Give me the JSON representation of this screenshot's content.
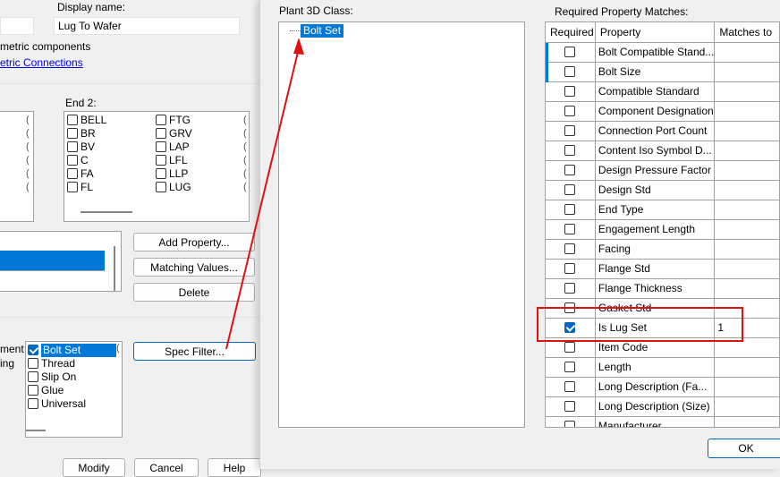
{
  "left_dialog": {
    "display_name_label": "Display name:",
    "display_name_value": "Lug To Wafer",
    "metric_components": "metric components",
    "metric_connections": "etric Connections",
    "end2_label": "End 2:",
    "end2_col1": [
      "BELL",
      "BR",
      "BV",
      "C",
      "FA",
      "FL"
    ],
    "end2_col2": [
      "FTG",
      "GRV",
      "LAP",
      "LFL",
      "LLP",
      "LUG"
    ],
    "add_property": "Add Property...",
    "matching_values": "Matching Values...",
    "delete": "Delete",
    "spec_filter": "Spec Filter...",
    "cut_label_1": "ment R",
    "cut_label_2": "ing",
    "spec_items": [
      {
        "label": "Bolt Set",
        "checked": true,
        "selected": true
      },
      {
        "label": "Thread",
        "checked": false
      },
      {
        "label": "Slip On",
        "checked": false
      },
      {
        "label": "Glue",
        "checked": false
      },
      {
        "label": "Universal",
        "checked": false
      }
    ],
    "modify": "Modify",
    "cancel": "Cancel",
    "help": "Help"
  },
  "right_dialog": {
    "plant_class_label": "Plant 3D Class:",
    "tree_selected": "Bolt Set",
    "required_label": "Required Property Matches:",
    "columns": [
      "Required",
      "Property",
      "Matches to"
    ],
    "rows": [
      {
        "property": "Bolt Compatible Stand...",
        "checked": false,
        "matches": ""
      },
      {
        "property": "Bolt Size",
        "checked": false,
        "matches": ""
      },
      {
        "property": "Compatible Standard",
        "checked": false,
        "matches": ""
      },
      {
        "property": "Component Designation",
        "checked": false,
        "matches": ""
      },
      {
        "property": "Connection Port Count",
        "checked": false,
        "matches": ""
      },
      {
        "property": "Content Iso Symbol D...",
        "checked": false,
        "matches": ""
      },
      {
        "property": "Design Pressure Factor",
        "checked": false,
        "matches": ""
      },
      {
        "property": "Design Std",
        "checked": false,
        "matches": ""
      },
      {
        "property": "End Type",
        "checked": false,
        "matches": ""
      },
      {
        "property": "Engagement Length",
        "checked": false,
        "matches": ""
      },
      {
        "property": "Facing",
        "checked": false,
        "matches": ""
      },
      {
        "property": "Flange Std",
        "checked": false,
        "matches": ""
      },
      {
        "property": "Flange Thickness",
        "checked": false,
        "matches": ""
      },
      {
        "property": "Gasket Std",
        "checked": false,
        "matches": ""
      },
      {
        "property": "Is Lug Set",
        "checked": true,
        "matches": "1"
      },
      {
        "property": "Item Code",
        "checked": false,
        "matches": ""
      },
      {
        "property": "Length",
        "checked": false,
        "matches": ""
      },
      {
        "property": "Long Description (Fa...",
        "checked": false,
        "matches": ""
      },
      {
        "property": "Long Description (Size)",
        "checked": false,
        "matches": ""
      },
      {
        "property": "Manufacturer",
        "checked": false,
        "matches": ""
      }
    ],
    "ok": "OK"
  },
  "colors": {
    "selection": "#0078d7",
    "annotation": "#e01010",
    "link": "#0000ee"
  }
}
